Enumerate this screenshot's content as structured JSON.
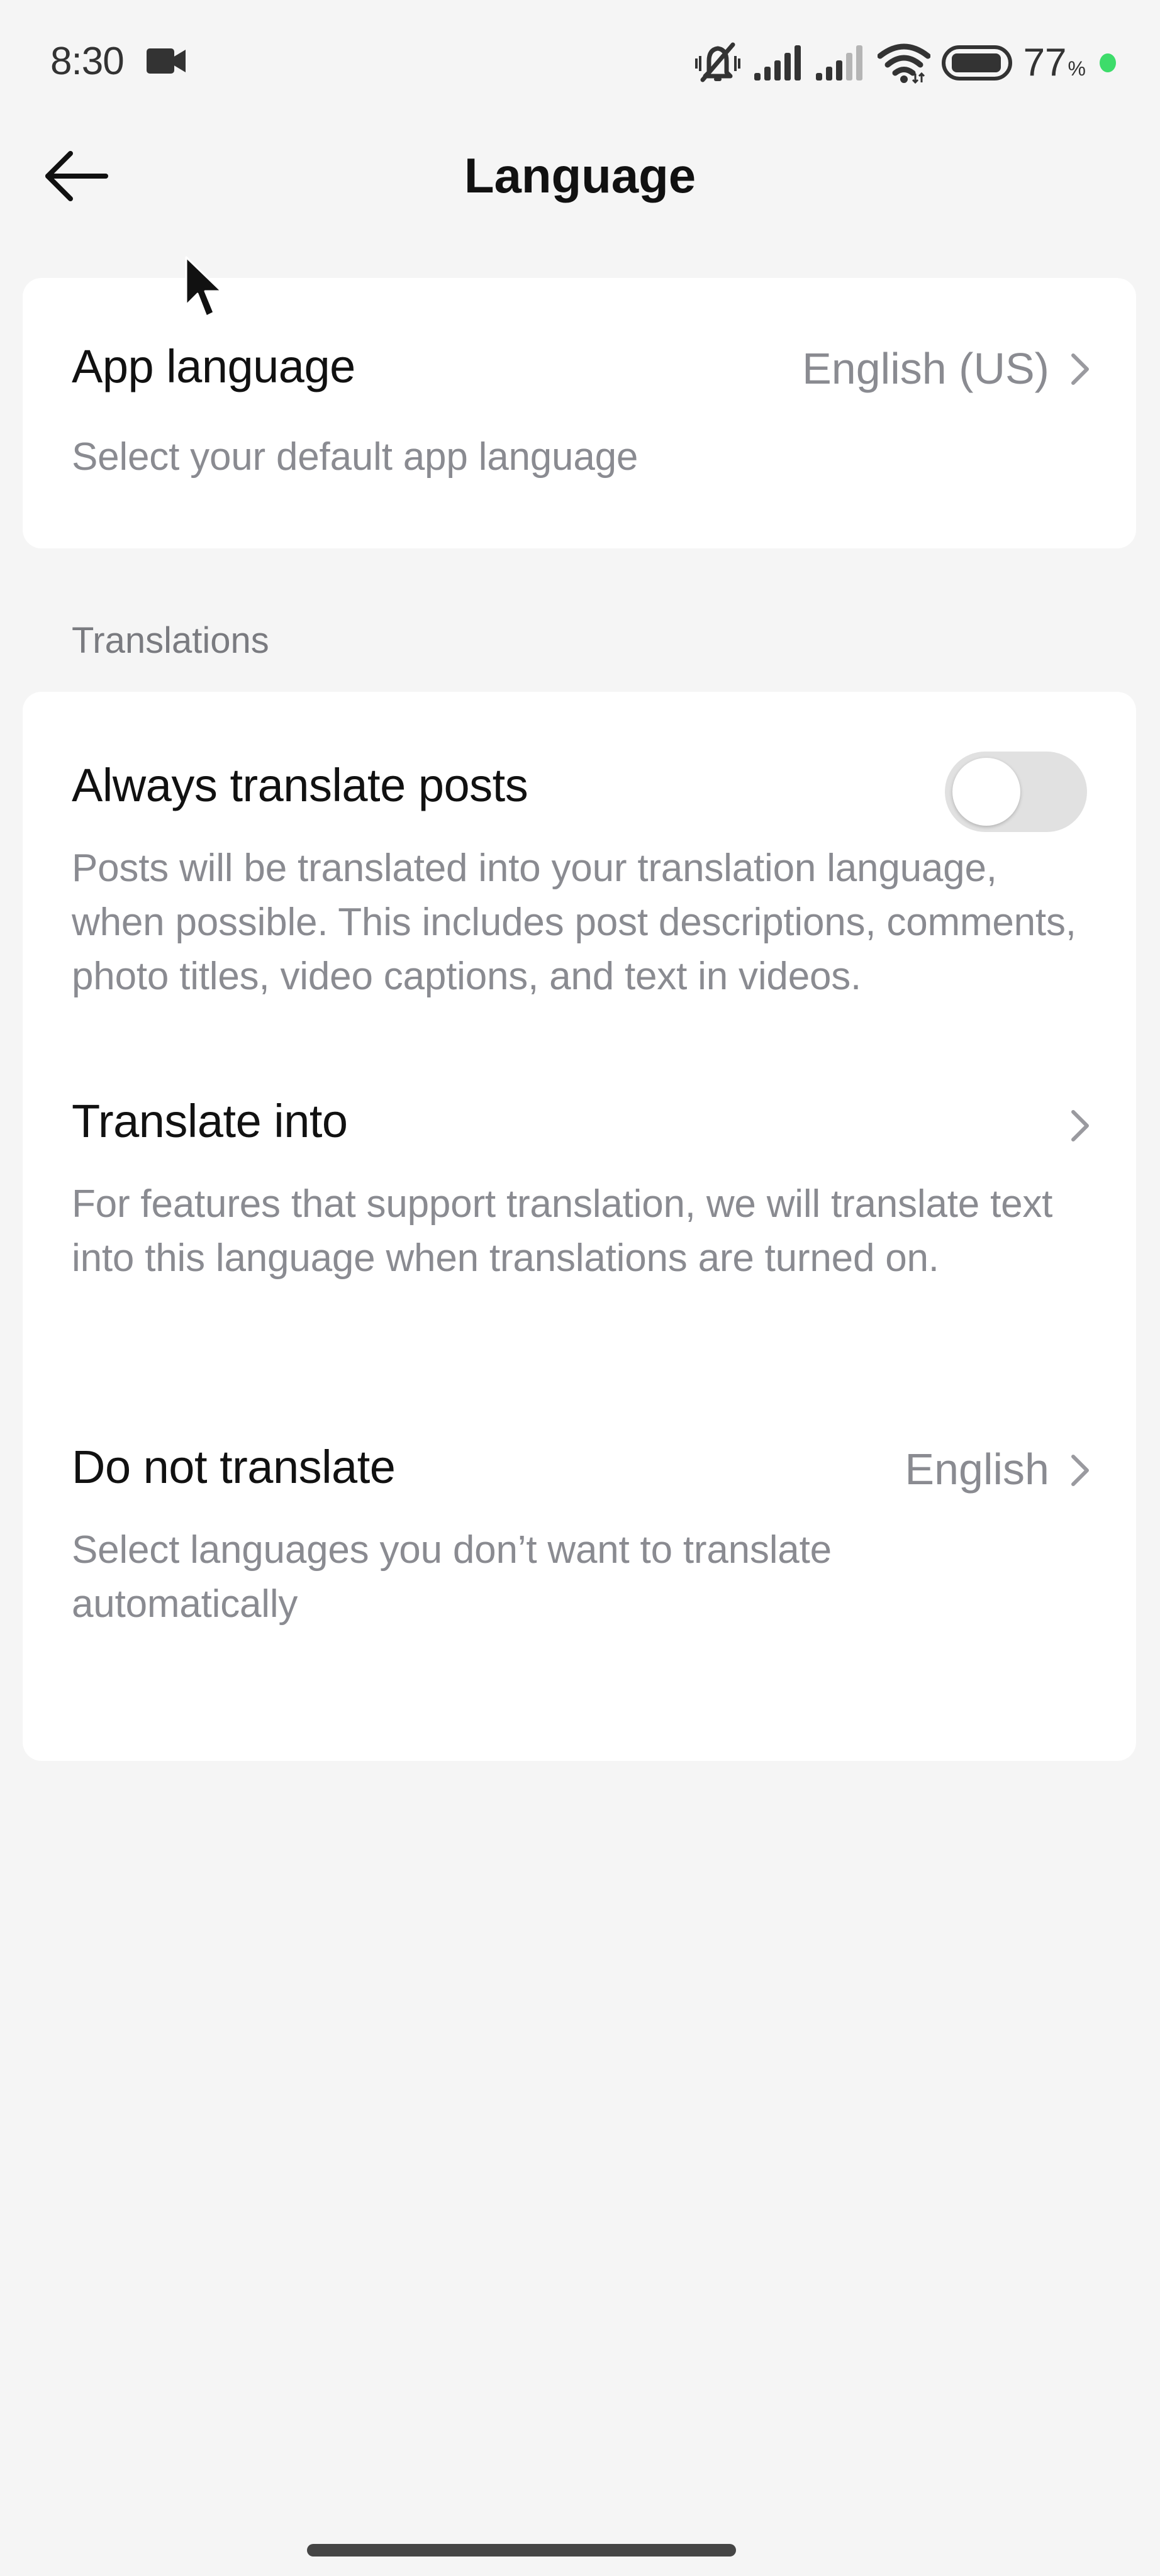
{
  "status_bar": {
    "time": "8:30",
    "battery_percent": "77",
    "battery_percent_sign": "%",
    "icons": [
      "camera-icon",
      "vibrate-mute-icon",
      "signal-full-icon",
      "signal-partial-icon",
      "wifi-icon",
      "battery-icon",
      "charging-dot-icon"
    ],
    "charging_color": "#3ddc6a"
  },
  "header": {
    "title": "Language",
    "back_icon": "back-arrow-icon"
  },
  "app_language": {
    "title": "App language",
    "value": "English (US)",
    "description": "Select your default app language"
  },
  "translations": {
    "section_label": "Translations",
    "always_translate": {
      "title": "Always translate posts",
      "description": "Posts will be translated into your translation language, when possible. This includes post descriptions, comments, photo titles, video captions, and text in videos.",
      "enabled": false
    },
    "translate_into": {
      "title": "Translate into",
      "value": "",
      "description": "For features that support translation, we will translate text into this language when translations are turned on."
    },
    "do_not_translate": {
      "title": "Do not translate",
      "value": "English",
      "description": "Select languages you don’t want to translate automatically"
    }
  }
}
